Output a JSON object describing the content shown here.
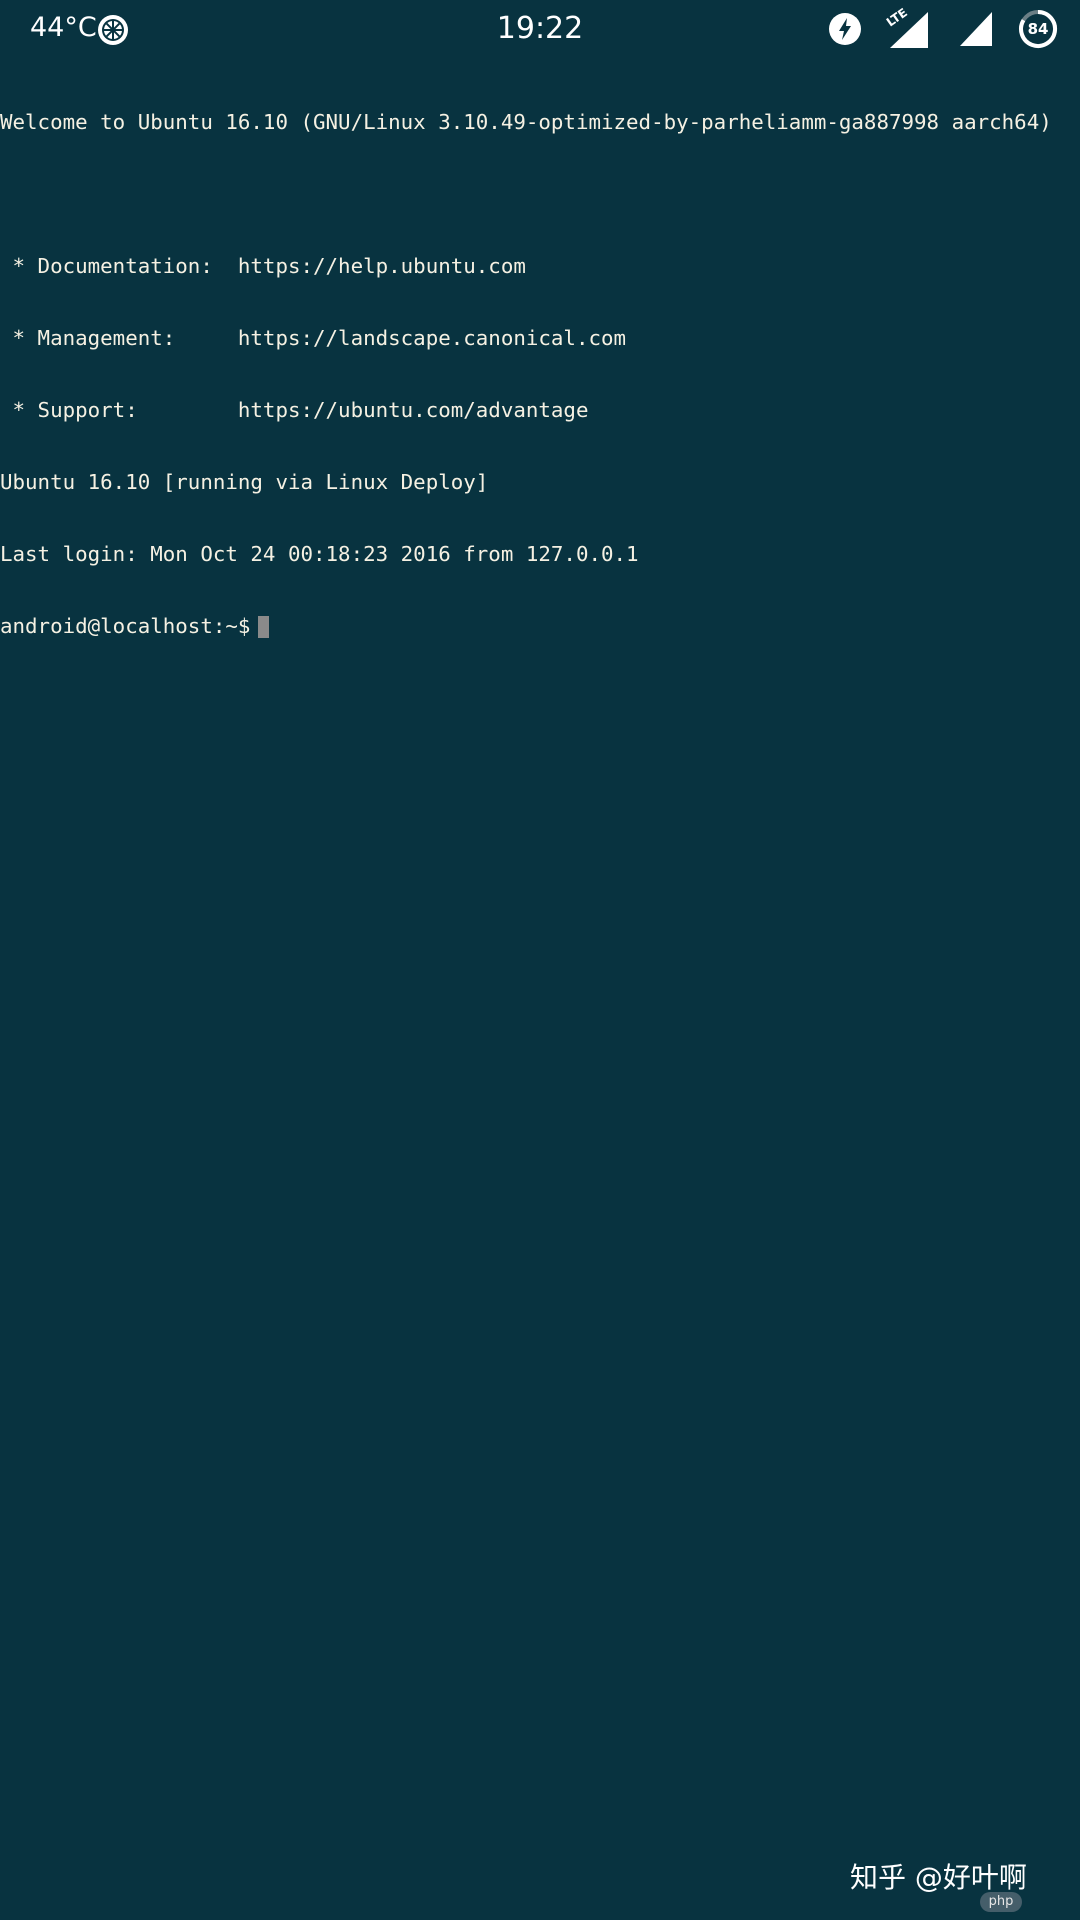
{
  "status_bar": {
    "temperature": "44°C",
    "time": "19:22",
    "network_label": "LTE",
    "battery_level": "84",
    "icons": [
      "orange-slice-icon",
      "flash-icon",
      "lte-signal-icon",
      "wifi-signal-icon",
      "battery-icon"
    ]
  },
  "terminal": {
    "lines": [
      "Welcome to Ubuntu 16.10 (GNU/Linux 3.10.49-optimized-by-parheliamm-ga887998 aarch64)",
      "",
      " * Documentation:  https://help.ubuntu.com",
      " * Management:     https://landscape.canonical.com",
      " * Support:        https://ubuntu.com/advantage",
      "Ubuntu 16.10 [running via Linux Deploy]",
      "Last login: Mon Oct 24 00:18:23 2016 from 127.0.0.1"
    ],
    "prompt": "android@localhost:~$",
    "background_color": "#083340",
    "text_color": "#f5f1e3"
  },
  "watermark": {
    "text": "知乎 @好叶啊",
    "badge": "php"
  }
}
